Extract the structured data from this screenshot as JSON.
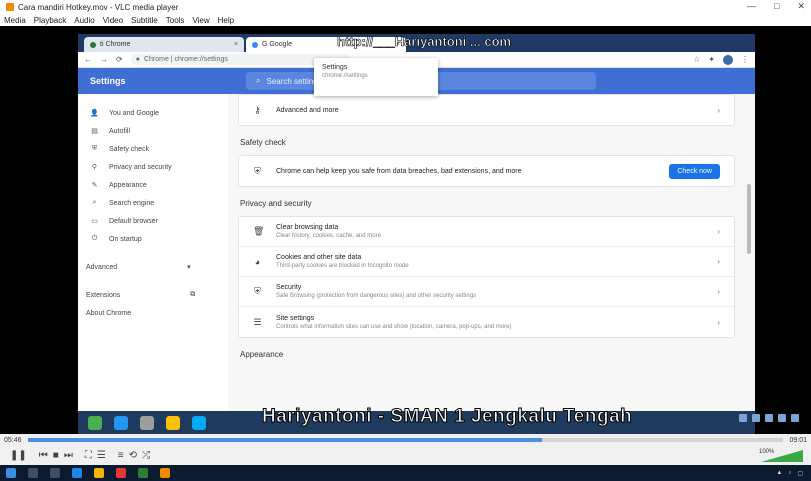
{
  "vlc": {
    "title": "Cara mandiri Hotkey.mov - VLC media player",
    "window_controls": [
      "—",
      "□",
      "✕"
    ],
    "menu": [
      "Media",
      "Playback",
      "Audio",
      "Video",
      "Subtitle",
      "Tools",
      "View",
      "Help"
    ],
    "time_elapsed": "05:46",
    "time_total": "09:01",
    "progress": 0.68,
    "volume_label": "100%"
  },
  "browser": {
    "tabs": [
      {
        "label": "ti Chrome",
        "active": false
      },
      {
        "label": "G Google",
        "active": true
      }
    ],
    "address": "Chrome | chrome://settings",
    "header_title": "Settings",
    "search_placeholder": "Search settings",
    "dropdown": {
      "title": "Settings",
      "subtitle": "chrome://settings"
    },
    "url_overlay": "http://___Hariyantoni ... com",
    "sidebar": [
      {
        "icon": "person-icon",
        "glyph": "👤",
        "label": "You and Google"
      },
      {
        "icon": "autofill-icon",
        "glyph": "▤",
        "label": "Autofill"
      },
      {
        "icon": "shield-icon",
        "glyph": "⛨",
        "label": "Safety check"
      },
      {
        "icon": "lock-icon",
        "glyph": "⚲",
        "label": "Privacy and security"
      },
      {
        "icon": "palette-icon",
        "glyph": "✎",
        "label": "Appearance"
      },
      {
        "icon": "search-icon",
        "glyph": "⌕",
        "label": "Search engine"
      },
      {
        "icon": "browser-icon",
        "glyph": "▭",
        "label": "Default browser"
      },
      {
        "icon": "power-icon",
        "glyph": "⏻",
        "label": "On startup"
      }
    ],
    "advanced_label": "Advanced",
    "extensions_label": "Extensions",
    "about_label": "About Chrome",
    "top_row": {
      "title": "Advanced and more"
    },
    "safety_section": "Safety check",
    "safety_text": "Chrome can help keep you safe from data breaches, bad extensions, and more",
    "check_now": "Check now",
    "privacy_section": "Privacy and security",
    "privacy_rows": [
      {
        "icon": "trash-icon",
        "glyph": "🗑",
        "title": "Clear browsing data",
        "sub": "Clear history, cookies, cache, and more"
      },
      {
        "icon": "cookie-icon",
        "glyph": "◕",
        "title": "Cookies and other site data",
        "sub": "Third-party cookies are blocked in Incognito mode"
      },
      {
        "icon": "security-icon",
        "glyph": "⛨",
        "title": "Security",
        "sub": "Safe Browsing (protection from dangerous sites) and other security settings"
      },
      {
        "icon": "site-settings-icon",
        "glyph": "☰",
        "title": "Site settings",
        "sub": "Controls what information sites can use and show (location, camera, pop-ups, and more)"
      }
    ],
    "appearance_section": "Appearance"
  },
  "caption": "Hariyantoni - SMAN 1 Jengkalu Tengah"
}
